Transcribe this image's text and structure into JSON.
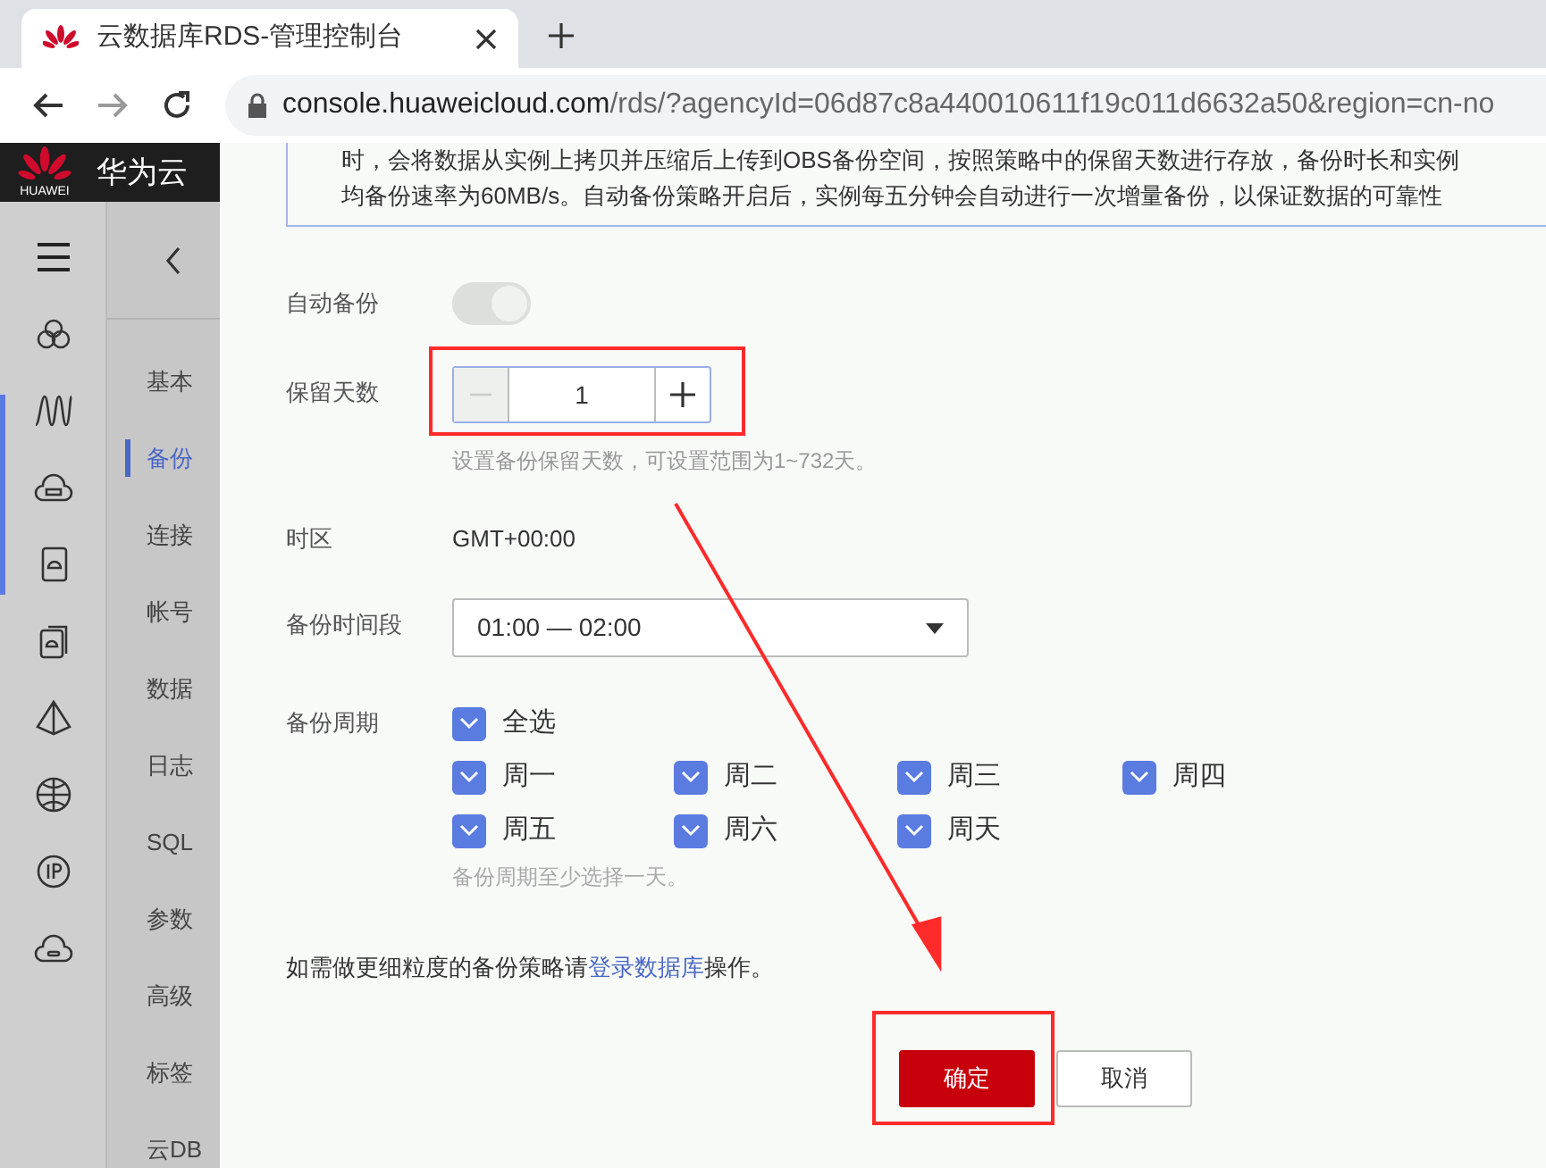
{
  "browser": {
    "tab_title": "云数据库RDS-管理控制台",
    "url_host": "console.huaweicloud.com",
    "url_path": "/rds/?agencyId=06d87c8a440010611f19c011d6632a50&region=cn-no"
  },
  "header": {
    "logo_caption": "HUAWEI",
    "brand": "华为云"
  },
  "nav": {
    "items": [
      {
        "label": "基本",
        "selected": false
      },
      {
        "label": "备份",
        "selected": true
      },
      {
        "label": "连接",
        "selected": false
      },
      {
        "label": "帐号",
        "selected": false
      },
      {
        "label": "数据",
        "selected": false
      },
      {
        "label": "日志",
        "selected": false
      },
      {
        "label": "SQL",
        "selected": false
      },
      {
        "label": "参数",
        "selected": false
      },
      {
        "label": "高级",
        "selected": false
      },
      {
        "label": "标签",
        "selected": false
      },
      {
        "label": "云DB",
        "selected": false
      }
    ]
  },
  "info": [
    "时，会将数据从实例上拷贝并压缩后上传到OBS备份空间，按照策略中的保留天数进行存放，备份时长和实例",
    "均备份速率为60MB/s。自动备份策略开启后，实例每五分钟会自动进行一次增量备份，以保证数据的可靠性"
  ],
  "form": {
    "auto_backup": {
      "label": "自动备份",
      "on": true,
      "disabled": true
    },
    "retention": {
      "label": "保留天数",
      "value": "1",
      "hint": "设置备份保留天数，可设置范围为1~732天。"
    },
    "timezone": {
      "label": "时区",
      "value": "GMT+00:00"
    },
    "window": {
      "label": "备份时间段",
      "value": "01:00 — 02:00"
    },
    "cycle": {
      "label": "备份周期",
      "select_all": {
        "label": "全选",
        "checked": true
      },
      "days": [
        {
          "label": "周一",
          "checked": true
        },
        {
          "label": "周二",
          "checked": true
        },
        {
          "label": "周三",
          "checked": true
        },
        {
          "label": "周四",
          "checked": true
        },
        {
          "label": "周五",
          "checked": true
        },
        {
          "label": "周六",
          "checked": true
        },
        {
          "label": "周天",
          "checked": true
        }
      ],
      "hint": "备份周期至少选择一天。"
    },
    "note": {
      "text": "如需做更细粒度的备份策略请",
      "link": "登录数据库",
      "after": "操作。"
    }
  },
  "buttons": [
    {
      "label": "确定",
      "kind": "primary"
    },
    {
      "label": "取消",
      "kind": "secondary"
    }
  ]
}
